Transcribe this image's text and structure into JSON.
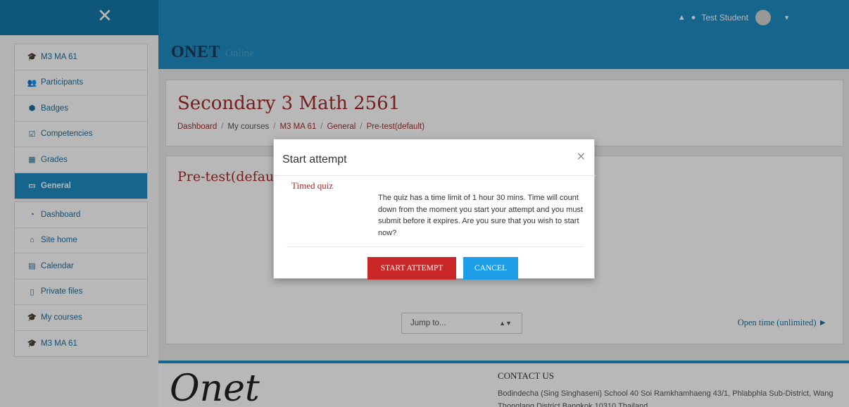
{
  "navbar": {
    "close_symbol": "✕",
    "user_name": "Test Student",
    "icons": {
      "notifications": "bell-icon",
      "messages": "chat-icon",
      "menu": "caret-down-icon"
    }
  },
  "sidebar": {
    "group1": [
      {
        "label": "M3 MA 61",
        "icon": "graduation-cap-icon",
        "glyph": "🎓"
      },
      {
        "label": "Participants",
        "icon": "users-icon",
        "glyph": "👥"
      },
      {
        "label": "Badges",
        "icon": "badge-icon",
        "glyph": "⬢"
      },
      {
        "label": "Competencies",
        "icon": "checkbox-icon",
        "glyph": "☑"
      },
      {
        "label": "Grades",
        "icon": "table-icon",
        "glyph": "▦"
      },
      {
        "label": "General",
        "icon": "folder-icon",
        "glyph": "▭",
        "active": true
      }
    ],
    "group2": [
      {
        "label": "Dashboard",
        "icon": "dashboard-icon",
        "glyph": "◔"
      },
      {
        "label": "Site home",
        "icon": "home-icon",
        "glyph": "⌂"
      },
      {
        "label": "Calendar",
        "icon": "calendar-icon",
        "glyph": "▤"
      },
      {
        "label": "Private files",
        "icon": "file-icon",
        "glyph": "▯"
      },
      {
        "label": "My courses",
        "icon": "graduation-cap-icon",
        "glyph": "🎓"
      },
      {
        "label": "M3 MA 61",
        "icon": "graduation-cap-icon",
        "glyph": "🎓"
      }
    ]
  },
  "brand": {
    "logo": "ONET",
    "sub": "Online"
  },
  "header": {
    "title": "Secondary 3 Math 2561",
    "breadcrumb": [
      "Dashboard",
      "My courses",
      "M3 MA 61",
      "General",
      "Pre-test(default)"
    ]
  },
  "quiz": {
    "title": "Pre-test(default)",
    "jump_placeholder": "Jump to...",
    "next_link": "Open time (unlimited) ►"
  },
  "footer": {
    "logo": "Onet",
    "contact_title": "CONTACT US",
    "contact_text": "Bodindecha (Sing Singhaseni) School 40 Soi Ramkhamhaeng 43/1, Phlabphla Sub-District, Wang Thonglang District Bangkok 10310 Thailand"
  },
  "modal": {
    "title": "Start attempt",
    "close": "×",
    "subtitle": "Timed quiz",
    "body": "The quiz has a time limit of 1 hour 30 mins. Time will count down from the moment you start your attempt and you must submit before it expires. Are you sure that you wish to start now?",
    "start_label": "START ATTEMPT",
    "cancel_label": "CANCEL"
  }
}
